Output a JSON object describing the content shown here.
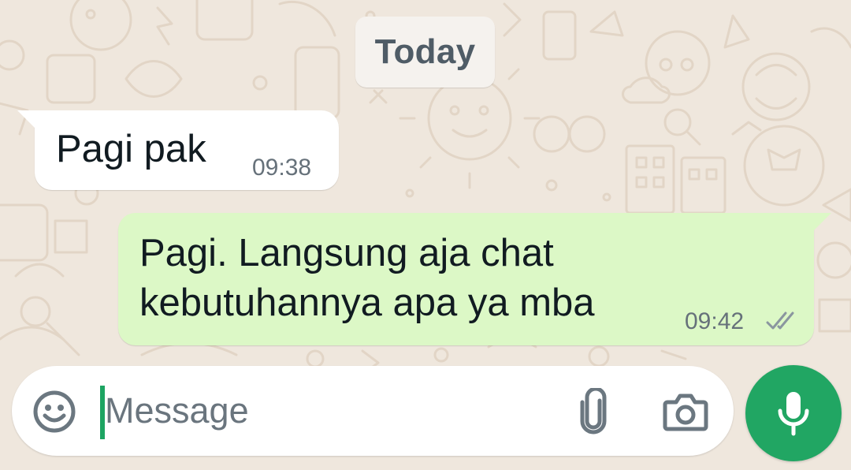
{
  "chat": {
    "date_label": "Today",
    "messages": [
      {
        "direction": "incoming",
        "text": "Pagi pak",
        "time": "09:38"
      },
      {
        "direction": "outgoing",
        "lines": [
          "Pagi. Langsung aja chat",
          "kebutuhannya apa ya mba"
        ],
        "time": "09:42",
        "status_icon": "double-check-icon"
      }
    ]
  },
  "composer": {
    "placeholder": "Message",
    "emoji_icon": "emoji-icon",
    "attach_icon": "paperclip-icon",
    "camera_icon": "camera-icon",
    "mic_icon": "microphone-icon"
  },
  "colors": {
    "wallpaper": "#efe7dd",
    "incoming_bubble": "#ffffff",
    "outgoing_bubble": "#dcf8c6",
    "accent": "#21a663"
  }
}
